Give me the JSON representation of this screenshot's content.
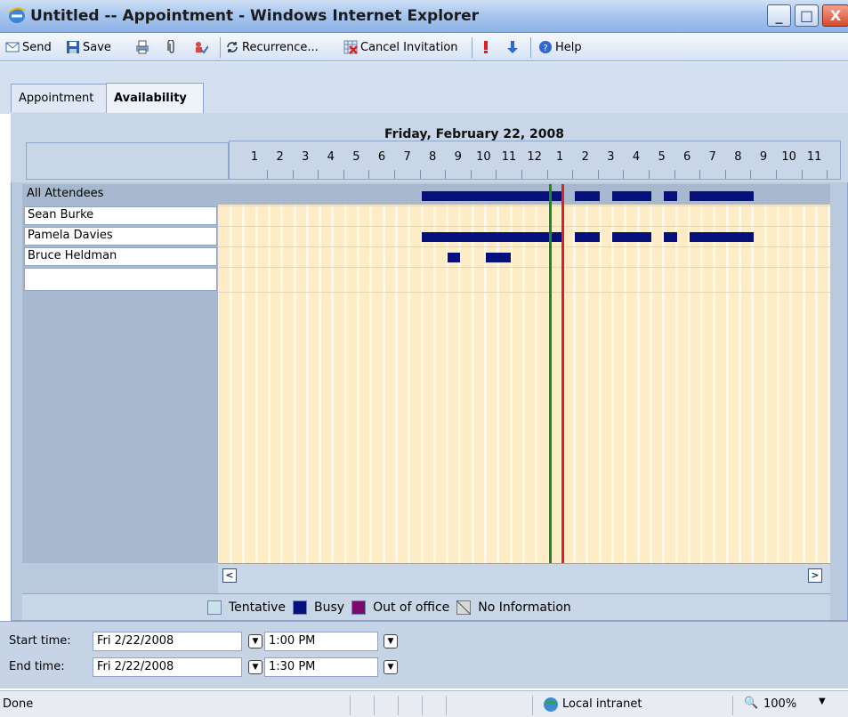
{
  "window": {
    "title": "Untitled -- Appointment - Windows Internet Explorer",
    "min": "_",
    "max": "□",
    "close": "X"
  },
  "toolbar": {
    "send": "Send",
    "save": "Save",
    "recurrence": "Recurrence...",
    "cancel_invitation": "Cancel Invitation",
    "help": "Help"
  },
  "tabs": [
    {
      "label": "Appointment"
    },
    {
      "label": "Availability"
    }
  ],
  "scheduler": {
    "date": "Friday, February 22, 2008",
    "hours": [
      "1",
      "2",
      "3",
      "4",
      "5",
      "6",
      "7",
      "8",
      "9",
      "10",
      "11",
      "12",
      "1",
      "2",
      "3",
      "4",
      "5",
      "6",
      "7",
      "8",
      "9",
      "10",
      "11"
    ],
    "attendees": [
      "All Attendees",
      "Sean Burke",
      "Pamela Davies",
      "Bruce Heldman"
    ],
    "scroll_left": "<",
    "scroll_right": ">"
  },
  "legend": {
    "tentative": "Tentative",
    "busy": "Busy",
    "out_of_office": "Out of office",
    "no_information": "No Information",
    "colors": {
      "tentative": "#c6e3ec",
      "busy": "#06107c",
      "out_of_office": "#7a0a6e",
      "no_information": "#d8d8d8"
    }
  },
  "times": {
    "start_label": "Start time:",
    "start_date": "Fri 2/22/2008",
    "start_time": "1:00 PM",
    "end_label": "End time:",
    "end_date": "Fri 2/22/2008",
    "end_time": "1:30 PM"
  },
  "status": {
    "text": "Done",
    "zone": "Local intranet",
    "zoom": "100%"
  }
}
